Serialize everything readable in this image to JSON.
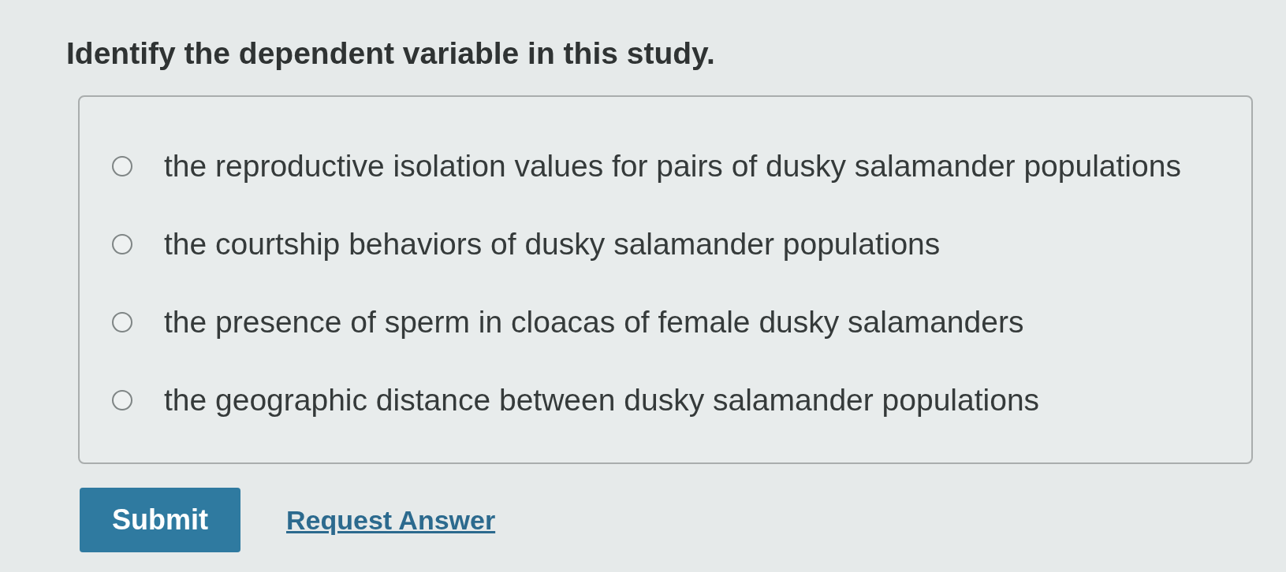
{
  "question": "Identify the dependent variable in this study.",
  "options": [
    {
      "label": "the reproductive isolation values for pairs of dusky salamander populations",
      "selected": false
    },
    {
      "label": "the courtship behaviors of dusky salamander populations",
      "selected": false
    },
    {
      "label": "the presence of sperm in cloacas of female dusky salamanders",
      "selected": false
    },
    {
      "label": "the geographic distance between dusky salamander populations",
      "selected": false
    }
  ],
  "actions": {
    "submit": "Submit",
    "request_answer": "Request Answer"
  }
}
